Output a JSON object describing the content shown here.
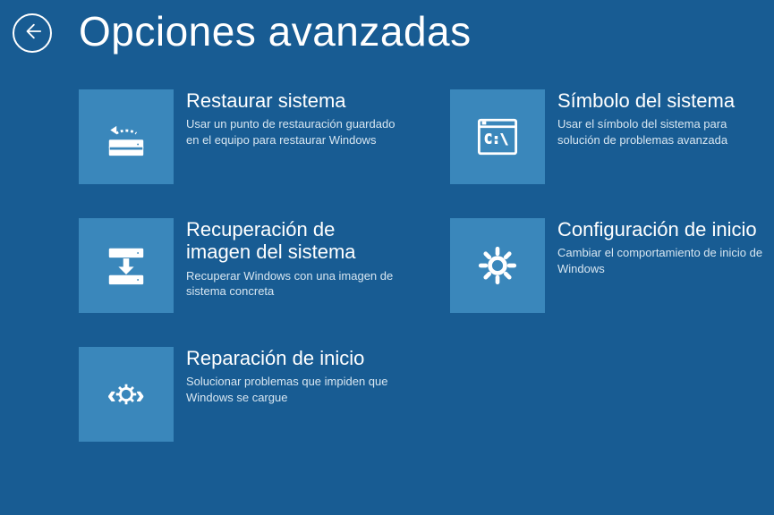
{
  "title": "Opciones avanzadas",
  "tiles": {
    "restore": {
      "title": "Restaurar sistema",
      "desc": "Usar un punto de restauración guardado en el equipo para restaurar Windows"
    },
    "imageRecovery": {
      "title": "Recuperación de imagen del sistema",
      "desc": "Recuperar Windows con una imagen de sistema concreta"
    },
    "startupRepair": {
      "title": "Reparación de inicio",
      "desc": "Solucionar problemas que impiden que Windows se cargue"
    },
    "cmd": {
      "title": "Símbolo del sistema",
      "desc": "Usar el símbolo del sistema para solución de problemas avanzada"
    },
    "startupSettings": {
      "title": "Configuración de inicio",
      "desc": "Cambiar el comportamiento de inicio de Windows"
    }
  }
}
